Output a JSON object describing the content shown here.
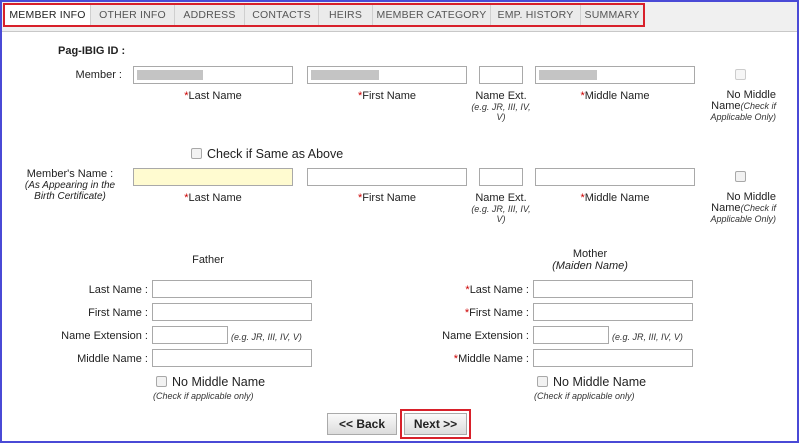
{
  "tabs": [
    "MEMBER INFO",
    "OTHER INFO",
    "ADDRESS",
    "CONTACTS",
    "HEIRS",
    "MEMBER CATEGORY",
    "EMP. HISTORY",
    "SUMMARY"
  ],
  "pagibig_id_label": "Pag-IBIG ID :",
  "member": {
    "label": "Member :",
    "last_name": "Last Name",
    "first_name": "First Name",
    "name_ext": "Name Ext.",
    "name_ext_hint": "(e.g. JR, III, IV, V)",
    "middle_name": "Middle Name",
    "no_middle": "No Middle Name",
    "no_middle_hint": "(Check if Applicable Only)",
    "required_mark": "*"
  },
  "same_as_above": "Check if Same as Above",
  "members_name": {
    "label": "Member's Name :",
    "sublabel": "(As Appearing in the Birth Certificate)"
  },
  "father": {
    "title": "Father",
    "last_name": "Last Name :",
    "first_name": "First Name :",
    "name_extension": "Name Extension :",
    "middle_name": "Middle Name :",
    "ext_hint": "(e.g. JR, III, IV, V)",
    "no_middle": "No Middle Name",
    "no_middle_hint": "(Check if applicable only)"
  },
  "mother": {
    "title": "Mother",
    "subtitle": "(Maiden Name)",
    "last_name": "Last Name :",
    "first_name": "First Name :",
    "name_extension": "Name Extension :",
    "middle_name": "Middle Name :",
    "ext_hint": "(e.g. JR, III, IV, V)",
    "no_middle": "No Middle Name",
    "no_middle_hint": "(Check if applicable only)"
  },
  "buttons": {
    "back": "<< Back",
    "next": "Next >>"
  },
  "colors": {
    "frame": "#4a4ad6",
    "highlight": "#d8202a",
    "required": "#cc0000",
    "focus_field": "#fffbd0"
  }
}
